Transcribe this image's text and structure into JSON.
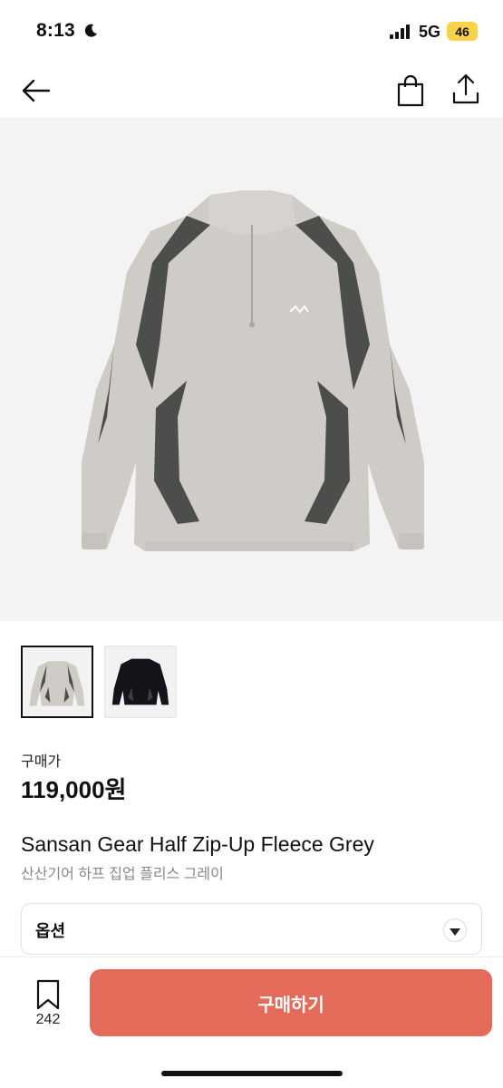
{
  "status_bar": {
    "time": "8:13",
    "network": "5G",
    "battery": "46"
  },
  "header": {
    "icons": [
      "back-arrow-icon",
      "shopping-bag-icon",
      "share-icon"
    ]
  },
  "product": {
    "image_thumbnails": [
      {
        "name": "grey",
        "selected": true
      },
      {
        "name": "black",
        "selected": false
      }
    ],
    "price_label": "구매가",
    "price": "119,000원",
    "name": "Sansan Gear Half Zip-Up Fleece Grey",
    "name_ko": "산산기어 하프 집업 플리스 그레이"
  },
  "option": {
    "label": "옵션"
  },
  "bottom_bar": {
    "wish_count": "242",
    "buy_label": "구매하기"
  },
  "colors": {
    "accent": "#e46a5a",
    "battery": "#f6d34a"
  }
}
